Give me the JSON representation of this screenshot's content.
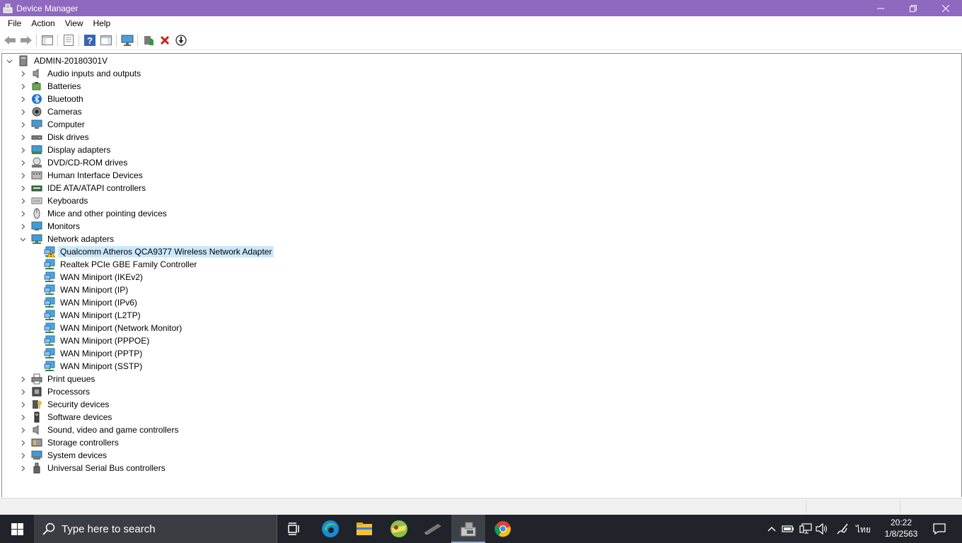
{
  "window": {
    "title": "Device Manager",
    "icon": "device-manager-icon",
    "title_bar_color": "#8f68c0"
  },
  "menu": [
    "File",
    "Action",
    "View",
    "Help"
  ],
  "toolbar_icons": [
    "back-arrow-icon",
    "forward-arrow-icon",
    "show-hide-console-tree-icon",
    "properties-icon",
    "help-icon",
    "action-pane-icon",
    "monitor-icon",
    "update-driver-icon",
    "uninstall-device-icon",
    "scan-hardware-changes-icon"
  ],
  "tree": {
    "root": "ADMIN-20180301V",
    "categories": [
      {
        "label": "Audio inputs and outputs",
        "icon": "speaker-icon"
      },
      {
        "label": "Batteries",
        "icon": "battery-icon"
      },
      {
        "label": "Bluetooth",
        "icon": "bluetooth-icon"
      },
      {
        "label": "Cameras",
        "icon": "camera-icon"
      },
      {
        "label": "Computer",
        "icon": "computer-icon"
      },
      {
        "label": "Disk drives",
        "icon": "disk-drive-icon"
      },
      {
        "label": "Display adapters",
        "icon": "display-adapter-icon"
      },
      {
        "label": "DVD/CD-ROM drives",
        "icon": "dvd-drive-icon"
      },
      {
        "label": "Human Interface Devices",
        "icon": "hid-icon"
      },
      {
        "label": "IDE ATA/ATAPI controllers",
        "icon": "ide-controller-icon"
      },
      {
        "label": "Keyboards",
        "icon": "keyboard-icon"
      },
      {
        "label": "Mice and other pointing devices",
        "icon": "mouse-icon"
      },
      {
        "label": "Monitors",
        "icon": "monitor-icon"
      },
      {
        "label": "Network adapters",
        "icon": "network-adapter-icon",
        "expanded": true,
        "children": [
          {
            "label": "Qualcomm Atheros QCA9377 Wireless Network Adapter",
            "warning": true,
            "selected": true
          },
          {
            "label": "Realtek PCIe GBE Family Controller"
          },
          {
            "label": "WAN Miniport (IKEv2)"
          },
          {
            "label": "WAN Miniport (IP)"
          },
          {
            "label": "WAN Miniport (IPv6)"
          },
          {
            "label": "WAN Miniport (L2TP)"
          },
          {
            "label": "WAN Miniport (Network Monitor)"
          },
          {
            "label": "WAN Miniport (PPPOE)"
          },
          {
            "label": "WAN Miniport (PPTP)"
          },
          {
            "label": "WAN Miniport (SSTP)"
          }
        ]
      },
      {
        "label": "Print queues",
        "icon": "printer-icon"
      },
      {
        "label": "Processors",
        "icon": "processor-icon"
      },
      {
        "label": "Security devices",
        "icon": "security-device-icon"
      },
      {
        "label": "Software devices",
        "icon": "software-device-icon"
      },
      {
        "label": "Sound, video and game controllers",
        "icon": "sound-controller-icon"
      },
      {
        "label": "Storage controllers",
        "icon": "storage-controller-icon"
      },
      {
        "label": "System devices",
        "icon": "system-device-icon"
      },
      {
        "label": "Universal Serial Bus controllers",
        "icon": "usb-icon"
      }
    ]
  },
  "taskbar": {
    "search_placeholder": "Type here to search",
    "apps": [
      "task-view-icon",
      "edge-icon",
      "file-explorer-icon",
      "game-app-icon",
      "pen-app-icon",
      "device-manager-icon",
      "chrome-icon"
    ],
    "active_app": "device-manager-icon",
    "tray_icons": [
      "chevron-up-icon",
      "battery-tray-icon",
      "network-tray-icon",
      "volume-icon",
      "pen-workspace-icon"
    ],
    "language": "ไทย",
    "time": "20:22",
    "date": "1/8/2563"
  }
}
